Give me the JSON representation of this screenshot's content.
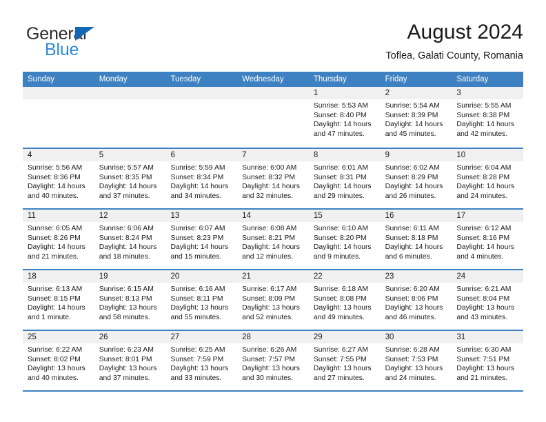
{
  "brand": {
    "name_top": "General",
    "name_bottom": "Blue",
    "triangle_color": "#1268b3",
    "blue_text_color": "#2e8ad4"
  },
  "header": {
    "title": "August 2024",
    "subtitle": "Toflea, Galati County, Romania"
  },
  "theme": {
    "header_blue": "#3d81c2",
    "day_number_bg": "#f0f0f0",
    "text": "#1a1a1a"
  },
  "weekdays": [
    "Sunday",
    "Monday",
    "Tuesday",
    "Wednesday",
    "Thursday",
    "Friday",
    "Saturday"
  ],
  "weeks": [
    [
      {
        "day": "",
        "sunrise": "",
        "sunset": "",
        "daylight1": "",
        "daylight2": ""
      },
      {
        "day": "",
        "sunrise": "",
        "sunset": "",
        "daylight1": "",
        "daylight2": ""
      },
      {
        "day": "",
        "sunrise": "",
        "sunset": "",
        "daylight1": "",
        "daylight2": ""
      },
      {
        "day": "",
        "sunrise": "",
        "sunset": "",
        "daylight1": "",
        "daylight2": ""
      },
      {
        "day": "1",
        "sunrise": "Sunrise: 5:53 AM",
        "sunset": "Sunset: 8:40 PM",
        "daylight1": "Daylight: 14 hours",
        "daylight2": "and 47 minutes."
      },
      {
        "day": "2",
        "sunrise": "Sunrise: 5:54 AM",
        "sunset": "Sunset: 8:39 PM",
        "daylight1": "Daylight: 14 hours",
        "daylight2": "and 45 minutes."
      },
      {
        "day": "3",
        "sunrise": "Sunrise: 5:55 AM",
        "sunset": "Sunset: 8:38 PM",
        "daylight1": "Daylight: 14 hours",
        "daylight2": "and 42 minutes."
      }
    ],
    [
      {
        "day": "4",
        "sunrise": "Sunrise: 5:56 AM",
        "sunset": "Sunset: 8:36 PM",
        "daylight1": "Daylight: 14 hours",
        "daylight2": "and 40 minutes."
      },
      {
        "day": "5",
        "sunrise": "Sunrise: 5:57 AM",
        "sunset": "Sunset: 8:35 PM",
        "daylight1": "Daylight: 14 hours",
        "daylight2": "and 37 minutes."
      },
      {
        "day": "6",
        "sunrise": "Sunrise: 5:59 AM",
        "sunset": "Sunset: 8:34 PM",
        "daylight1": "Daylight: 14 hours",
        "daylight2": "and 34 minutes."
      },
      {
        "day": "7",
        "sunrise": "Sunrise: 6:00 AM",
        "sunset": "Sunset: 8:32 PM",
        "daylight1": "Daylight: 14 hours",
        "daylight2": "and 32 minutes."
      },
      {
        "day": "8",
        "sunrise": "Sunrise: 6:01 AM",
        "sunset": "Sunset: 8:31 PM",
        "daylight1": "Daylight: 14 hours",
        "daylight2": "and 29 minutes."
      },
      {
        "day": "9",
        "sunrise": "Sunrise: 6:02 AM",
        "sunset": "Sunset: 8:29 PM",
        "daylight1": "Daylight: 14 hours",
        "daylight2": "and 26 minutes."
      },
      {
        "day": "10",
        "sunrise": "Sunrise: 6:04 AM",
        "sunset": "Sunset: 8:28 PM",
        "daylight1": "Daylight: 14 hours",
        "daylight2": "and 24 minutes."
      }
    ],
    [
      {
        "day": "11",
        "sunrise": "Sunrise: 6:05 AM",
        "sunset": "Sunset: 8:26 PM",
        "daylight1": "Daylight: 14 hours",
        "daylight2": "and 21 minutes."
      },
      {
        "day": "12",
        "sunrise": "Sunrise: 6:06 AM",
        "sunset": "Sunset: 8:24 PM",
        "daylight1": "Daylight: 14 hours",
        "daylight2": "and 18 minutes."
      },
      {
        "day": "13",
        "sunrise": "Sunrise: 6:07 AM",
        "sunset": "Sunset: 8:23 PM",
        "daylight1": "Daylight: 14 hours",
        "daylight2": "and 15 minutes."
      },
      {
        "day": "14",
        "sunrise": "Sunrise: 6:08 AM",
        "sunset": "Sunset: 8:21 PM",
        "daylight1": "Daylight: 14 hours",
        "daylight2": "and 12 minutes."
      },
      {
        "day": "15",
        "sunrise": "Sunrise: 6:10 AM",
        "sunset": "Sunset: 8:20 PM",
        "daylight1": "Daylight: 14 hours",
        "daylight2": "and 9 minutes."
      },
      {
        "day": "16",
        "sunrise": "Sunrise: 6:11 AM",
        "sunset": "Sunset: 8:18 PM",
        "daylight1": "Daylight: 14 hours",
        "daylight2": "and 6 minutes."
      },
      {
        "day": "17",
        "sunrise": "Sunrise: 6:12 AM",
        "sunset": "Sunset: 8:16 PM",
        "daylight1": "Daylight: 14 hours",
        "daylight2": "and 4 minutes."
      }
    ],
    [
      {
        "day": "18",
        "sunrise": "Sunrise: 6:13 AM",
        "sunset": "Sunset: 8:15 PM",
        "daylight1": "Daylight: 14 hours",
        "daylight2": "and 1 minute."
      },
      {
        "day": "19",
        "sunrise": "Sunrise: 6:15 AM",
        "sunset": "Sunset: 8:13 PM",
        "daylight1": "Daylight: 13 hours",
        "daylight2": "and 58 minutes."
      },
      {
        "day": "20",
        "sunrise": "Sunrise: 6:16 AM",
        "sunset": "Sunset: 8:11 PM",
        "daylight1": "Daylight: 13 hours",
        "daylight2": "and 55 minutes."
      },
      {
        "day": "21",
        "sunrise": "Sunrise: 6:17 AM",
        "sunset": "Sunset: 8:09 PM",
        "daylight1": "Daylight: 13 hours",
        "daylight2": "and 52 minutes."
      },
      {
        "day": "22",
        "sunrise": "Sunrise: 6:18 AM",
        "sunset": "Sunset: 8:08 PM",
        "daylight1": "Daylight: 13 hours",
        "daylight2": "and 49 minutes."
      },
      {
        "day": "23",
        "sunrise": "Sunrise: 6:20 AM",
        "sunset": "Sunset: 8:06 PM",
        "daylight1": "Daylight: 13 hours",
        "daylight2": "and 46 minutes."
      },
      {
        "day": "24",
        "sunrise": "Sunrise: 6:21 AM",
        "sunset": "Sunset: 8:04 PM",
        "daylight1": "Daylight: 13 hours",
        "daylight2": "and 43 minutes."
      }
    ],
    [
      {
        "day": "25",
        "sunrise": "Sunrise: 6:22 AM",
        "sunset": "Sunset: 8:02 PM",
        "daylight1": "Daylight: 13 hours",
        "daylight2": "and 40 minutes."
      },
      {
        "day": "26",
        "sunrise": "Sunrise: 6:23 AM",
        "sunset": "Sunset: 8:01 PM",
        "daylight1": "Daylight: 13 hours",
        "daylight2": "and 37 minutes."
      },
      {
        "day": "27",
        "sunrise": "Sunrise: 6:25 AM",
        "sunset": "Sunset: 7:59 PM",
        "daylight1": "Daylight: 13 hours",
        "daylight2": "and 33 minutes."
      },
      {
        "day": "28",
        "sunrise": "Sunrise: 6:26 AM",
        "sunset": "Sunset: 7:57 PM",
        "daylight1": "Daylight: 13 hours",
        "daylight2": "and 30 minutes."
      },
      {
        "day": "29",
        "sunrise": "Sunrise: 6:27 AM",
        "sunset": "Sunset: 7:55 PM",
        "daylight1": "Daylight: 13 hours",
        "daylight2": "and 27 minutes."
      },
      {
        "day": "30",
        "sunrise": "Sunrise: 6:28 AM",
        "sunset": "Sunset: 7:53 PM",
        "daylight1": "Daylight: 13 hours",
        "daylight2": "and 24 minutes."
      },
      {
        "day": "31",
        "sunrise": "Sunrise: 6:30 AM",
        "sunset": "Sunset: 7:51 PM",
        "daylight1": "Daylight: 13 hours",
        "daylight2": "and 21 minutes."
      }
    ]
  ]
}
